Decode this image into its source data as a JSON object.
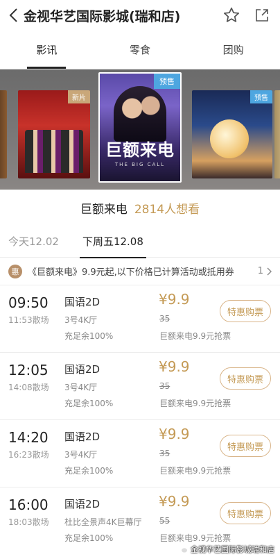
{
  "header": {
    "title": "金视华艺国际影城(瑞和店)"
  },
  "tabs": [
    {
      "label": "影讯"
    },
    {
      "label": "零食"
    },
    {
      "label": "团购"
    }
  ],
  "carousel": {
    "posters": [
      {
        "badge": "新片",
        "title": ""
      },
      {
        "badge": "预售",
        "title": "巨额来电",
        "subtitle": "THE BIG CALL"
      },
      {
        "badge": "预售",
        "title": ""
      }
    ]
  },
  "movie": {
    "name": "巨额来电",
    "want": "2814人想看"
  },
  "dates": [
    {
      "label": "今天12.02"
    },
    {
      "label": "下周五12.08"
    }
  ],
  "promo": {
    "badge": "惠",
    "text": "《巨额来电》9.9元起,以下价格已计算活动或抵用券",
    "count": "1"
  },
  "showtimes": [
    {
      "time": "09:50",
      "end": "11:53散场",
      "lang": "国语2D",
      "hall": "3号4K厅",
      "seats": "充足余100%",
      "price": "¥9.9",
      "orig": "35",
      "promo": "巨额来电9.9元抢票",
      "button": "特惠购票"
    },
    {
      "time": "12:05",
      "end": "14:08散场",
      "lang": "国语2D",
      "hall": "3号4K厅",
      "seats": "充足余100%",
      "price": "¥9.9",
      "orig": "35",
      "promo": "巨额来电9.9元抢票",
      "button": "特惠购票"
    },
    {
      "time": "14:20",
      "end": "16:23散场",
      "lang": "国语2D",
      "hall": "3号4K厅",
      "seats": "充足余100%",
      "price": "¥9.9",
      "orig": "35",
      "promo": "巨额来电9.9元抢票",
      "button": "特惠购票"
    },
    {
      "time": "16:00",
      "end": "18:03散场",
      "lang": "国语2D",
      "hall": "杜比全景声4K巨幕厅",
      "seats": "充足余100%",
      "price": "¥9.9",
      "orig": "55",
      "promo": "巨额来电9.9元抢票",
      "button": "特惠购票"
    }
  ],
  "watermark": "金视华艺国际影城瑞和店",
  "colors": {
    "accent": "#c49a55",
    "button_border": "#d9b58a",
    "badge_blue": "#4ea6e0",
    "badge_gold": "#c9a779"
  }
}
